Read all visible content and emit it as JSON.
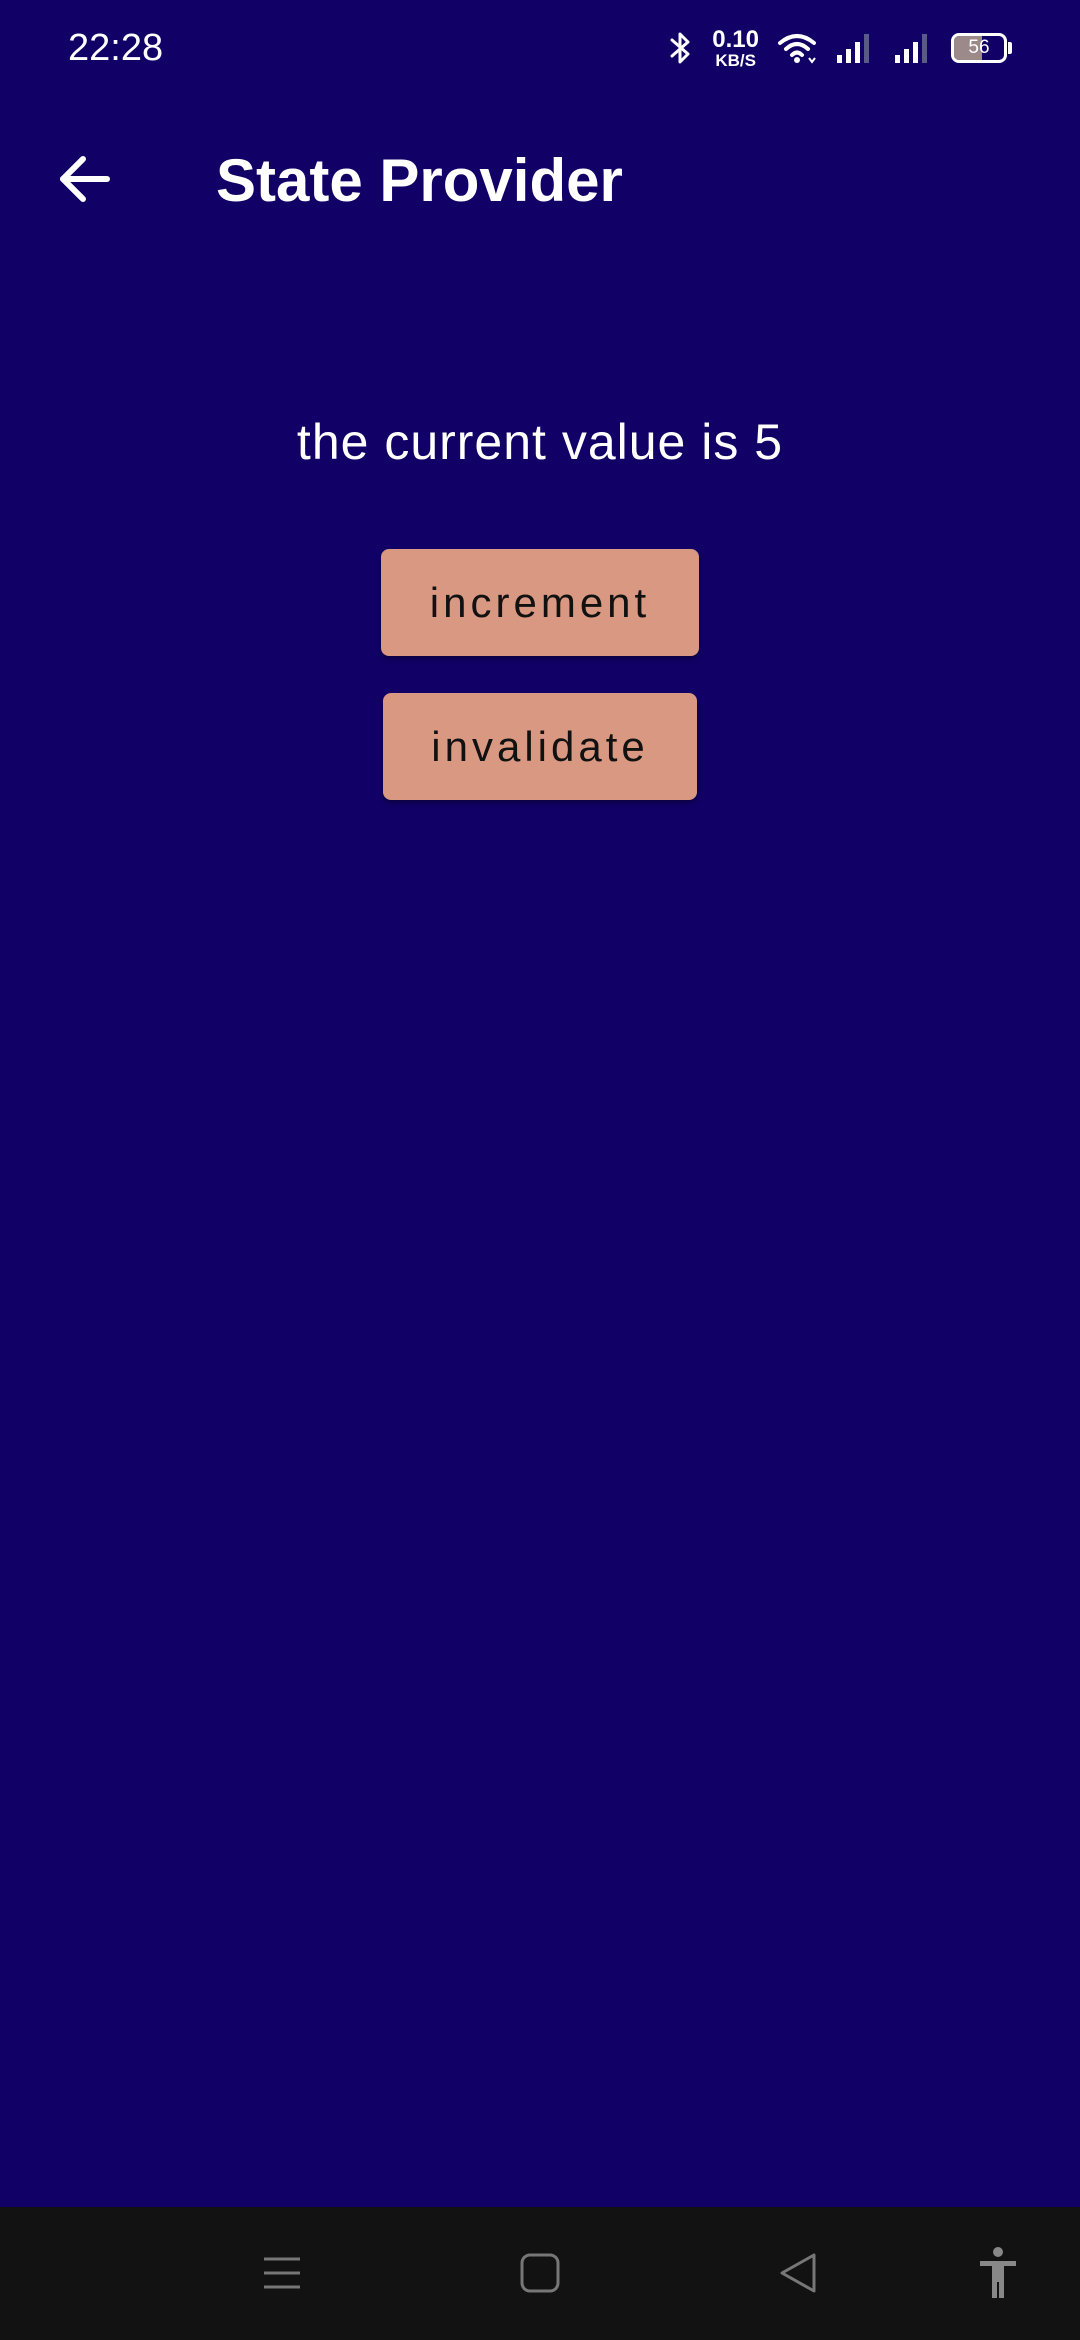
{
  "status_bar": {
    "time": "22:28",
    "net_speed_value": "0.10",
    "net_speed_unit": "KB/S",
    "battery_level": "56",
    "icons": [
      "bluetooth-icon",
      "wifi-icon",
      "signal-1-icon",
      "signal-2-icon",
      "battery-icon"
    ]
  },
  "app_bar": {
    "title": "State Provider",
    "back_icon": "arrow-left-icon"
  },
  "main": {
    "value_text": "the current value is 5",
    "increment_label": "increment",
    "invalidate_label": "invalidate"
  },
  "nav_bar": {
    "icons": [
      "menu-icon",
      "home-icon",
      "back-icon",
      "accessibility-icon"
    ]
  },
  "colors": {
    "background": "#110066",
    "button": "#d99882",
    "button_text": "#111111",
    "nav_bar": "#121212"
  }
}
